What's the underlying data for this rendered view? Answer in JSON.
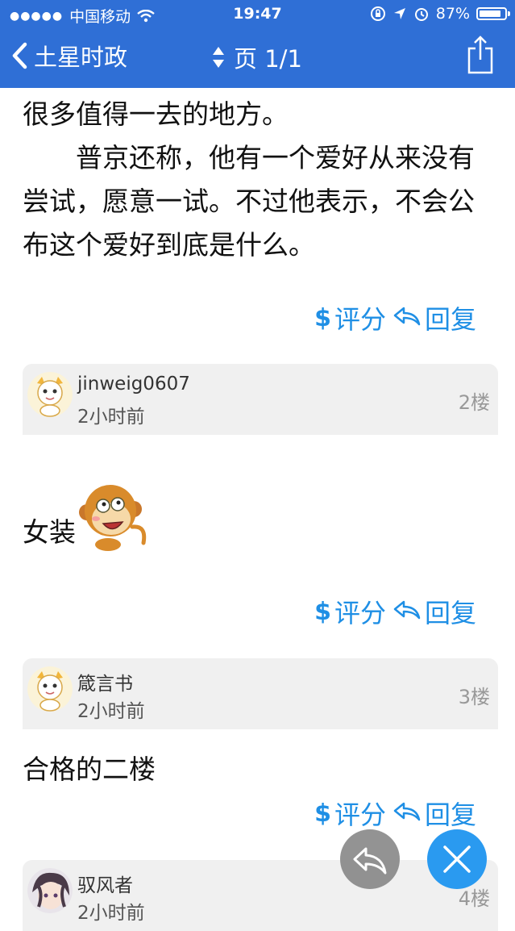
{
  "status_bar": {
    "signal": "●●●●●",
    "carrier": "中国移动",
    "time": "19:47",
    "battery": "87%",
    "battery_level": 0.87
  },
  "nav": {
    "back_label": "土星时政",
    "page_label": "页 1/1"
  },
  "article": {
    "line1": "很多值得一去的地方。",
    "paragraph2": "普京还称，他有一个爱好从来没有尝试，愿意一试。不过他表示，不会公布这个爱好到底是什么。"
  },
  "actions": {
    "rate_icon": "$",
    "rate_label": "评分",
    "reply_label": "回复"
  },
  "posts": [
    {
      "username": "jinweig0607",
      "time": "2小时前",
      "floor": "2楼",
      "content": "女装"
    },
    {
      "username": "箴言书",
      "time": "2小时前",
      "floor": "3楼",
      "content": "合格的二楼"
    },
    {
      "username": "驭风者",
      "time": "2小时前",
      "floor": "4楼",
      "content": ""
    }
  ],
  "colors": {
    "header": "#2f6fd6",
    "accent": "#1f8fe5",
    "post_header_bg": "#f0f0f0"
  }
}
